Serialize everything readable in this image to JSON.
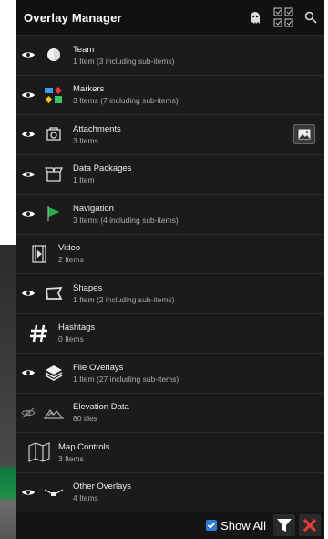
{
  "header": {
    "title": "Overlay Manager"
  },
  "items": [
    {
      "name": "Team",
      "sub": "1 Item (3 including sub-items)"
    },
    {
      "name": "Markers",
      "sub": "3 Items (7 including sub-items)"
    },
    {
      "name": "Attachments",
      "sub": "3 Items"
    },
    {
      "name": "Data Packages",
      "sub": "1 Item"
    },
    {
      "name": "Navigation",
      "sub": "3 Items (4 including sub-items)"
    },
    {
      "name": "Video",
      "sub": "2 Items"
    },
    {
      "name": "Shapes",
      "sub": "1 Item (2 including sub-items)"
    },
    {
      "name": "Hashtags",
      "sub": "0 Items"
    },
    {
      "name": "File Overlays",
      "sub": "1 Item (27 including sub-items)"
    },
    {
      "name": "Elevation Data",
      "sub": "80 tiles"
    },
    {
      "name": "Map Controls",
      "sub": "3 Items"
    },
    {
      "name": "Other Overlays",
      "sub": "4 Items"
    }
  ],
  "footer": {
    "show_all_label": "Show All",
    "show_all_checked": true
  },
  "colors": {
    "accent": "#2e7bd6",
    "close": "#e53935",
    "navigation": "#22b14c"
  }
}
